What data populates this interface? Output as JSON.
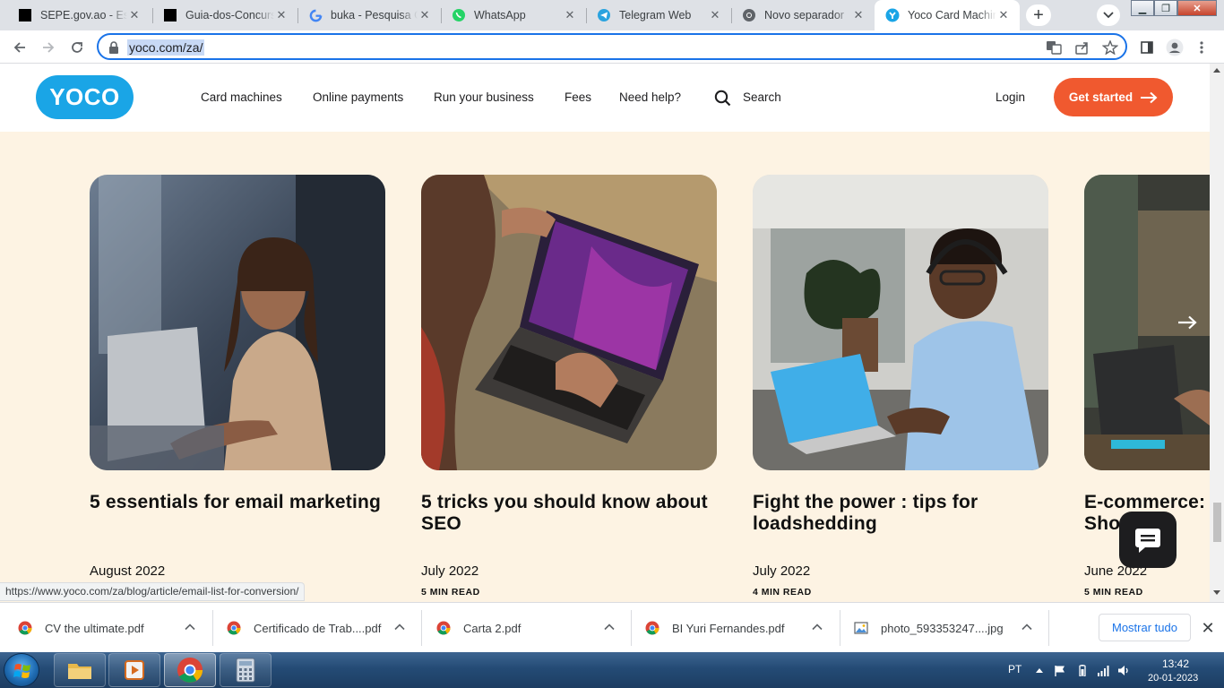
{
  "browser": {
    "tabs": [
      {
        "title": "SEPE.gov.ao - Espe",
        "icon": "black-square-icon",
        "active": false
      },
      {
        "title": "Guia-dos-Concurs",
        "icon": "black-square-icon",
        "active": false
      },
      {
        "title": "buka - Pesquisa G",
        "icon": "google-icon",
        "active": false
      },
      {
        "title": "WhatsApp",
        "icon": "whatsapp-icon",
        "active": false
      },
      {
        "title": "Telegram Web",
        "icon": "telegram-icon",
        "active": false
      },
      {
        "title": "Novo separador",
        "icon": "chrome-icon",
        "active": false
      },
      {
        "title": "Yoco Card Machin",
        "icon": "yoco-icon",
        "active": true
      }
    ],
    "url": "yoco.com/za/",
    "status_url": "https://www.yoco.com/za/blog/article/email-list-for-conversion/"
  },
  "site": {
    "logo_text": "YOCO",
    "nav": [
      "Card machines",
      "Online payments",
      "Run your business",
      "Fees",
      "Need help?"
    ],
    "search_label": "Search",
    "login_label": "Login",
    "cta_label": "Get started",
    "brand_color": "#1aa5e6",
    "accent_color": "#f0592f",
    "background_color": "#fdf3e3"
  },
  "articles": [
    {
      "title": "5 essentials for email marketing",
      "date": "August 2022",
      "read_time": "",
      "image": "woman-with-laptop-photo"
    },
    {
      "title": "5 tricks you should know about SEO",
      "date": "July 2022",
      "read_time": "5 MIN READ",
      "image": "hands-on-laptop-photo"
    },
    {
      "title": "Fight the power : tips for loadshedding",
      "date": "July 2022",
      "read_time": "4 MIN READ",
      "image": "man-with-headset-laptop-photo"
    },
    {
      "title": "E-commerce: Shop can",
      "date": "June 2022",
      "read_time": "5 MIN READ",
      "image": "workshop-laptop-photo"
    }
  ],
  "downloads": [
    {
      "name": "CV the ultimate.pdf",
      "icon": "chrome-icon"
    },
    {
      "name": "Certificado de Trab....pdf",
      "icon": "chrome-icon"
    },
    {
      "name": "Carta 2.pdf",
      "icon": "chrome-icon"
    },
    {
      "name": "BI Yuri Fernandes.pdf",
      "icon": "chrome-icon"
    },
    {
      "name": "photo_593353247....jpg",
      "icon": "image-file-icon"
    }
  ],
  "show_all_label": "Mostrar tudo",
  "taskbar": {
    "apps": [
      "file-explorer-icon",
      "media-player-icon",
      "chrome-icon",
      "calculator-icon"
    ],
    "language": "PT",
    "time": "13:42",
    "date": "20-01-2023"
  }
}
